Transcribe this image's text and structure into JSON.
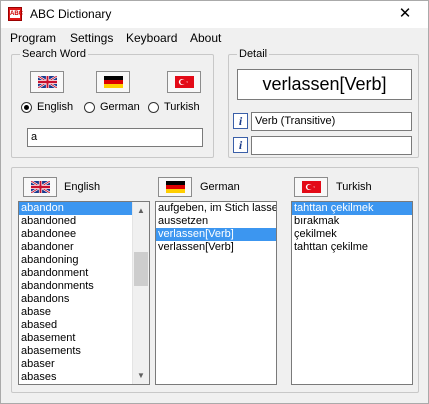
{
  "window": {
    "title": "ABC Dictionary",
    "icon": "abc-app-icon"
  },
  "titlebar": {
    "minimize": "—",
    "maximize": "☐",
    "close": "✕"
  },
  "menu": [
    "Program",
    "Settings",
    "Keyboard",
    "About"
  ],
  "search": {
    "group_title": "Search Word",
    "flags": [
      "uk-flag",
      "german-flag",
      "turkish-flag"
    ],
    "languages": [
      {
        "label": "English",
        "selected": true
      },
      {
        "label": "German",
        "selected": false
      },
      {
        "label": "Turkish",
        "selected": false
      }
    ],
    "value": "a"
  },
  "detail": {
    "group_title": "Detail",
    "word": "verlassen[Verb]",
    "info1": "Verb (Transitive)",
    "info2": ""
  },
  "lists": {
    "english": {
      "label": "English",
      "items": [
        "abandon",
        "abandoned",
        "abandonee",
        "abandoner",
        "abandoning",
        "abandonment",
        "abandonments",
        "abandons",
        "abase",
        "abased",
        "abasement",
        "abasements",
        "abaser",
        "abases"
      ],
      "selected": 0
    },
    "german": {
      "label": "German",
      "items": [
        "aufgeben, im Stich lassen",
        "aussetzen",
        "verlassen[Verb]",
        "verlassen[Verb]"
      ],
      "selected": 2
    },
    "turkish": {
      "label": "Turkish",
      "items": [
        "tahttan çekilmek",
        "bırakmak",
        "çekilmek",
        "tahttan çekilme"
      ],
      "selected": 0
    }
  },
  "colors": {
    "selection": "#3c96f0",
    "window_bg": "#f0f0f0"
  }
}
